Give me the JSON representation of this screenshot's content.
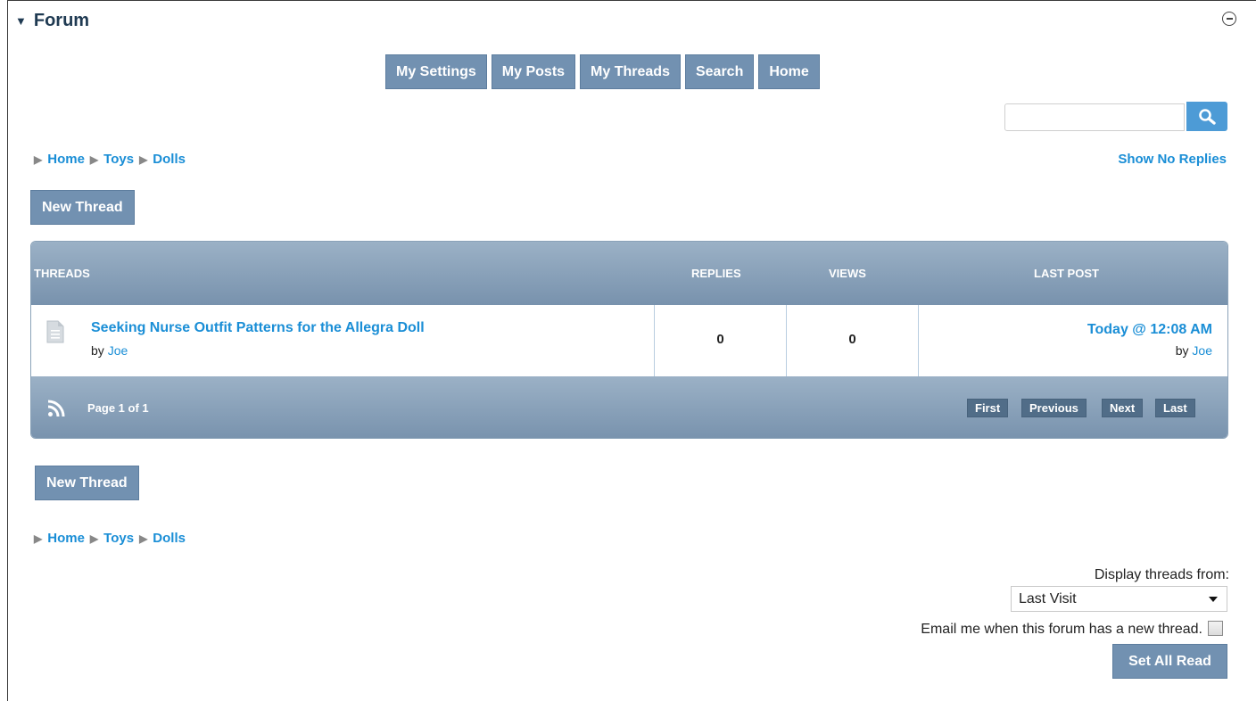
{
  "header": {
    "title": "Forum"
  },
  "nav": {
    "buttons": [
      "My Settings",
      "My Posts",
      "My Threads",
      "Search",
      "Home"
    ]
  },
  "search": {
    "placeholder": ""
  },
  "breadcrumb": {
    "items": [
      "Home",
      "Toys",
      "Dolls"
    ]
  },
  "show_no_replies": "Show No Replies",
  "new_thread_label": "New Thread",
  "table": {
    "columns": {
      "threads": "THREADS",
      "replies": "REPLIES",
      "views": "VIEWS",
      "last_post": "LAST POST"
    },
    "rows": [
      {
        "title": "Seeking Nurse Outfit Patterns for the Allegra Doll",
        "by_prefix": "by",
        "author": "Joe",
        "replies": "0",
        "views": "0",
        "last_post_time": "Today @ 12:08 AM",
        "last_post_by_prefix": "by",
        "last_post_author": "Joe"
      }
    ],
    "page_info": "Page 1 of 1",
    "pager": {
      "first": "First",
      "previous": "Previous",
      "next": "Next",
      "last": "Last"
    }
  },
  "footer": {
    "display_label": "Display threads from:",
    "display_value": "Last Visit",
    "email_label": "Email me when this forum has a new thread.",
    "set_all_read": "Set All Read"
  },
  "colors": {
    "button": "#7291b1",
    "link": "#1a8ed6",
    "header": "#1f3a52"
  }
}
